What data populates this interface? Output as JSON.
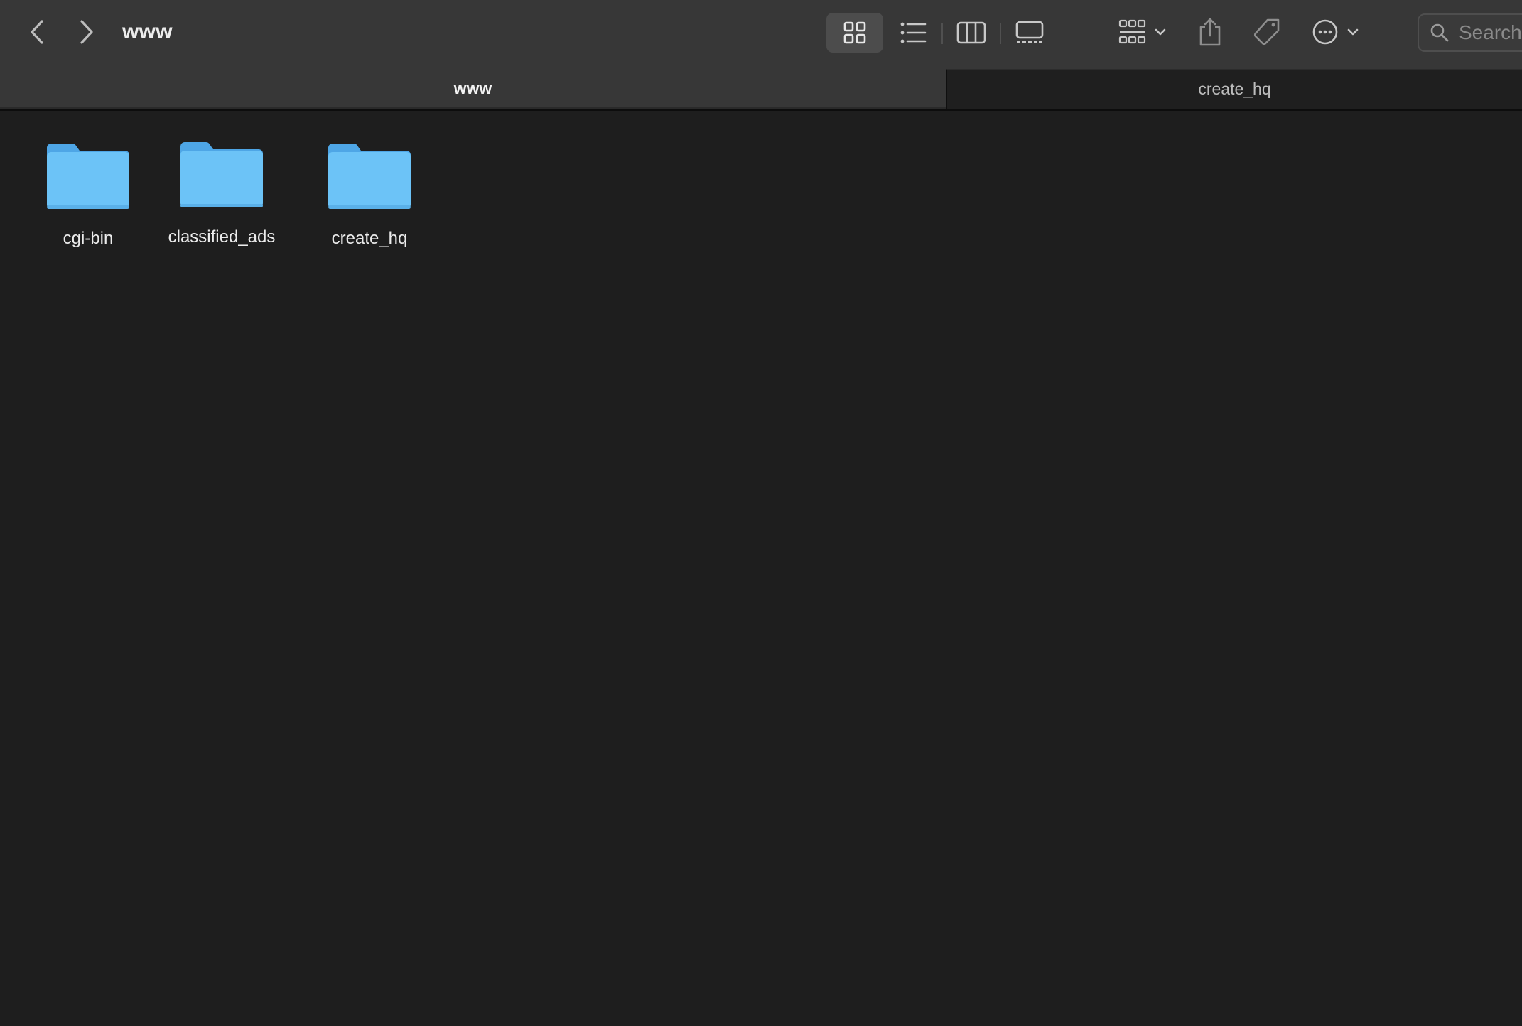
{
  "window": {
    "title": "www"
  },
  "toolbar": {
    "back_icon": "chevron-left-icon",
    "forward_icon": "chevron-right-icon",
    "views": [
      {
        "name": "icon-view",
        "icon": "grid-icon",
        "active": true
      },
      {
        "name": "list-view",
        "icon": "list-icon",
        "active": false
      },
      {
        "name": "column-view",
        "icon": "columns-icon",
        "active": false
      },
      {
        "name": "gallery-view",
        "icon": "gallery-icon",
        "active": false
      }
    ],
    "group_icon": "group-grid-icon",
    "share_icon": "share-icon",
    "tag_icon": "tag-icon",
    "more_icon": "ellipsis-circle-icon"
  },
  "search": {
    "placeholder": "Search",
    "value": ""
  },
  "tabs": [
    {
      "label": "www",
      "active": true
    },
    {
      "label": "create_hq",
      "active": false
    }
  ],
  "folders": [
    {
      "name": "cgi-bin"
    },
    {
      "name": "classified_ads"
    },
    {
      "name": "create_hq"
    }
  ],
  "colors": {
    "toolbar_bg": "#373737",
    "content_bg": "#1e1e1e",
    "folder_blue": "#6cc3f7",
    "folder_tab": "#4ea6e6"
  }
}
